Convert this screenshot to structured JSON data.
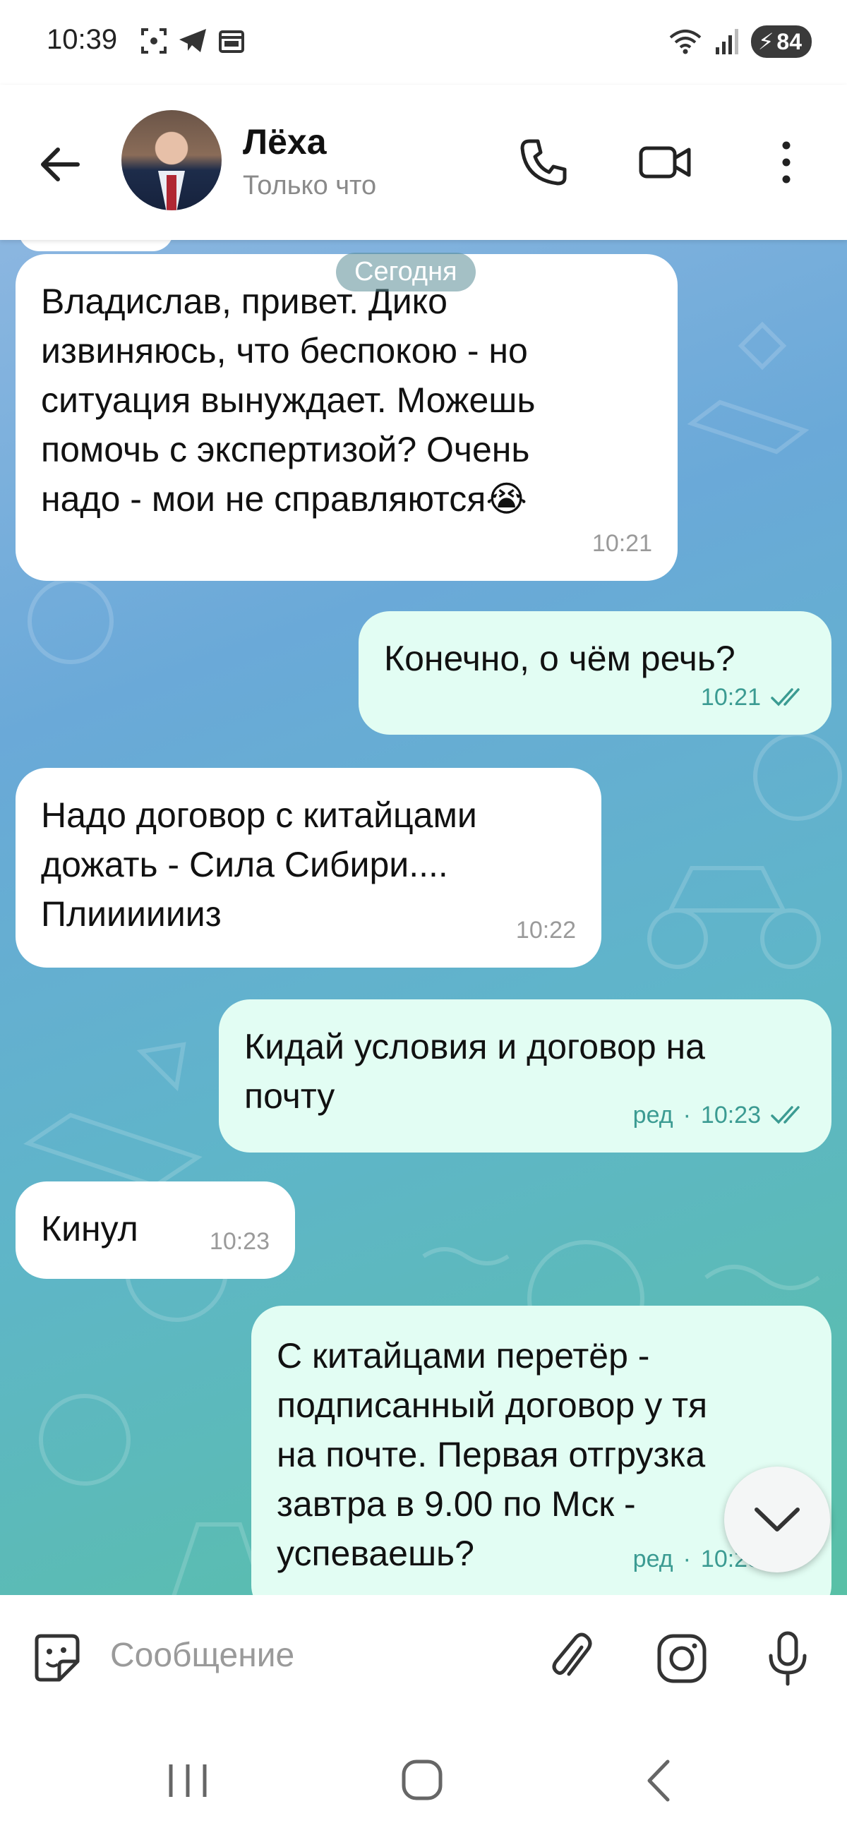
{
  "status_bar": {
    "time": "10:39",
    "battery": "84",
    "icons": [
      "screenshot-icon",
      "telegram-icon",
      "calendar-icon",
      "wifi-icon",
      "signal-icon",
      "battery-icon"
    ]
  },
  "header": {
    "contact_name": "Лёха",
    "status": "Только что",
    "icons": [
      "back-arrow-icon",
      "phone-icon",
      "video-camera-icon",
      "more-vert-icon"
    ]
  },
  "chat": {
    "date_label": "Сегодня",
    "messages": [
      {
        "direction": "incoming",
        "text": "Владислав, привет. Дико\nизвиняюсь, что беспокою - но\nситуация вынуждает. Можешь\nпомочь с экспертизой? Очень\nнадо - мои не справляются😭",
        "time": "10:21"
      },
      {
        "direction": "outgoing",
        "text": "Конечно, о чём речь?",
        "time": "10:21",
        "read": true
      },
      {
        "direction": "incoming",
        "text": "Надо договор с китайцами\nдожать - Сила Сибири....\nПлииииииз",
        "time": "10:22"
      },
      {
        "direction": "outgoing",
        "text": "Кидай условия и договор на\nпочту",
        "edited_label": "ред",
        "time": "10:23",
        "read": true
      },
      {
        "direction": "incoming",
        "text": "Кинул",
        "time": "10:23"
      },
      {
        "direction": "outgoing",
        "text": "С китайцами перетёр -\nподписанный договор у тя\nна почте. Первая отгрузка\nзавтра в 9.00 по Мск -\nуспеваешь?",
        "edited_label": "ред",
        "time": "10:25",
        "read": true
      }
    ]
  },
  "input": {
    "placeholder": "Сообщение",
    "icons": [
      "sticker-icon",
      "attach-icon",
      "camera-icon",
      "microphone-icon"
    ]
  },
  "nav": {
    "icons": [
      "recent-apps-icon",
      "home-icon",
      "back-icon"
    ]
  },
  "colors": {
    "incoming_bubble": "#ffffff",
    "outgoing_bubble": "#e2fdf3",
    "meta_outgoing": "#3b9b92",
    "chat_bg_top": "#8bb6e0",
    "chat_bg_bottom": "#58c0a6"
  }
}
